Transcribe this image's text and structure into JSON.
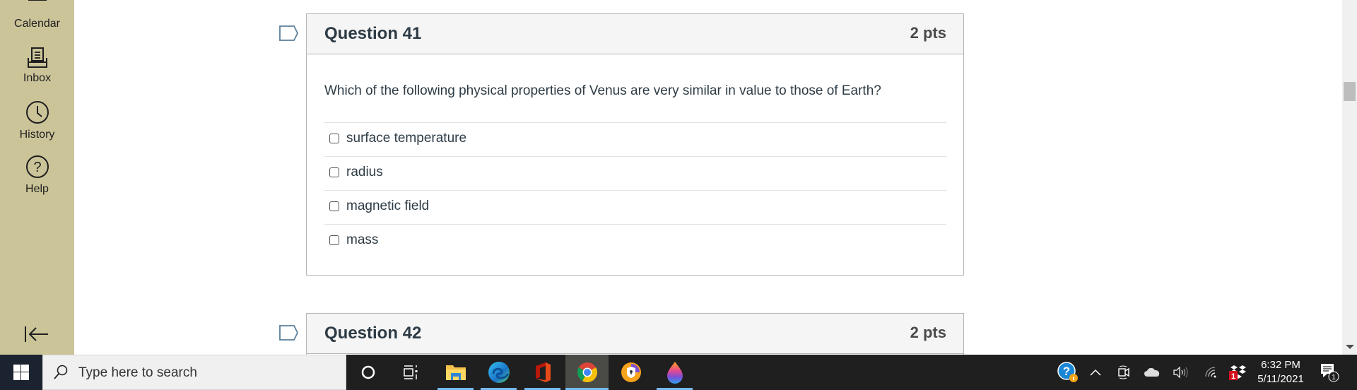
{
  "sidebar": {
    "items": [
      {
        "label": "Calendar",
        "icon": "calendar-icon"
      },
      {
        "label": "Inbox",
        "icon": "inbox-icon"
      },
      {
        "label": "History",
        "icon": "clock-icon"
      },
      {
        "label": "Help",
        "icon": "help-circle-icon"
      }
    ],
    "collapse_icon": "collapse-arrow-icon",
    "background": "#cbc499"
  },
  "questions": [
    {
      "title": "Question 41",
      "points": "2 pts",
      "text": "Which of the following physical properties of Venus are very similar in value to those of Earth?",
      "answers": [
        {
          "label": "surface temperature",
          "checked": false
        },
        {
          "label": "radius",
          "checked": false
        },
        {
          "label": "magnetic field",
          "checked": false
        },
        {
          "label": "mass",
          "checked": false
        }
      ]
    },
    {
      "title": "Question 42",
      "points": "2 pts"
    }
  ],
  "taskbar": {
    "search_placeholder": "Type here to search",
    "apps": [
      {
        "name": "File Explorer",
        "icon": "file-explorer-icon",
        "running": true,
        "active": false
      },
      {
        "name": "Microsoft Edge",
        "icon": "edge-icon",
        "running": true,
        "active": false
      },
      {
        "name": "Office",
        "icon": "office-icon",
        "running": true,
        "active": false
      },
      {
        "name": "Google Chrome",
        "icon": "chrome-icon",
        "running": true,
        "active": true
      },
      {
        "name": "Brave",
        "icon": "brave-icon",
        "running": false,
        "active": false
      },
      {
        "name": "Paint 3D",
        "icon": "paint-icon",
        "running": true,
        "active": false
      }
    ],
    "tray": {
      "time": "6:32 PM",
      "date": "5/11/2021",
      "dropbox_badge": "1",
      "notification_count": "1"
    }
  }
}
